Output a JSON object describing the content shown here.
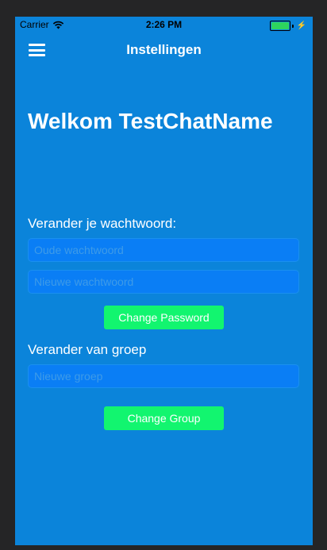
{
  "status_bar": {
    "carrier": "Carrier",
    "time": "2:26 PM",
    "battery_level": 1.0,
    "battery_color": "#2ED45E"
  },
  "nav": {
    "title": "Instellingen",
    "menu_icon": "hamburger-menu-icon"
  },
  "welcome": {
    "text": "Welkom TestChatName"
  },
  "password_section": {
    "label": "Verander je wachtwoord:",
    "old_placeholder": "Oude wachtwoord",
    "new_placeholder": "Nieuwe wachtwoord",
    "button_label": "Change Password"
  },
  "group_section": {
    "label": "Verander van groep",
    "group_placeholder": "Nieuwe groep",
    "button_label": "Change Group"
  },
  "colors": {
    "background": "#0B84DA",
    "button": "#12F56F",
    "input": "#0A7EF5"
  }
}
